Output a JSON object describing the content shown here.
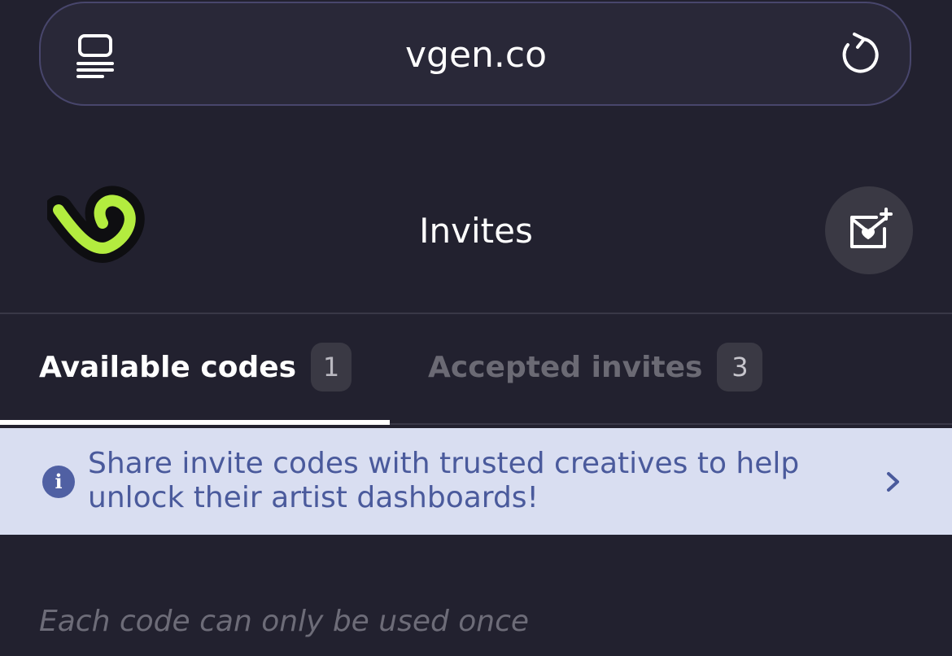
{
  "browser": {
    "url": "vgen.co",
    "reader_icon": "reader-mode-icon",
    "reload_icon": "reload-icon"
  },
  "header": {
    "logo": "vgen-logo",
    "title": "Invites",
    "action_icon": "invite-envelope-icon"
  },
  "tabs": [
    {
      "label": "Available codes",
      "count": "1",
      "active": true
    },
    {
      "label": "Accepted invites",
      "count": "3",
      "active": false
    }
  ],
  "info_banner": {
    "icon": "info-icon",
    "icon_glyph": "i",
    "line1": "Share invite codes with trusted creatives to help",
    "line2": "unlock their artist dashboards!",
    "chevron_icon": "chevron-right-icon"
  },
  "hint": "Each code can only be used once",
  "colors": {
    "background": "#22212f",
    "brand_green": "#b3ec3f",
    "banner_bg": "#d9def1",
    "banner_text": "#4a5a9c"
  }
}
